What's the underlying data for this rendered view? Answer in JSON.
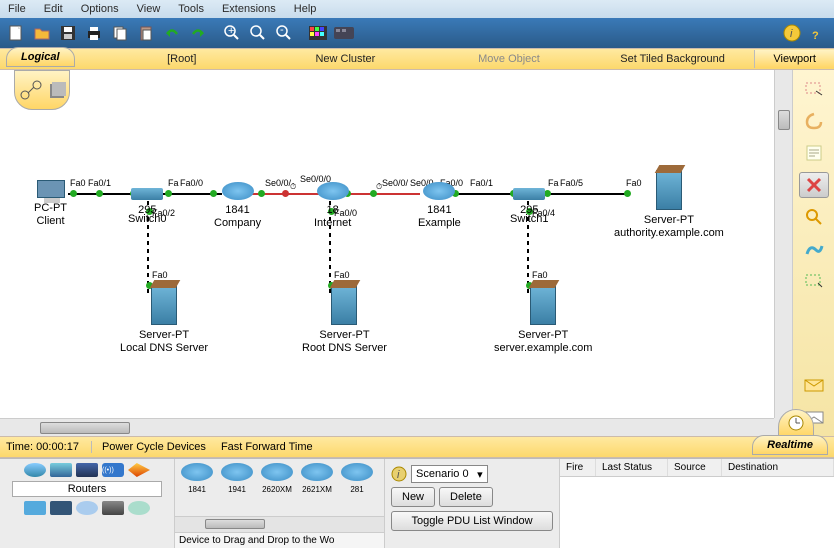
{
  "menu": [
    "File",
    "Edit",
    "Options",
    "View",
    "Tools",
    "Extensions",
    "Help"
  ],
  "logical": {
    "tab": "Logical",
    "root": "[Root]",
    "newcluster": "New Cluster",
    "move": "Move Object",
    "tiled": "Set Tiled Background",
    "viewport": "Viewport"
  },
  "time_label": "Time: 00:00:17",
  "power": "Power Cycle Devices",
  "fft": "Fast Forward Time",
  "realtime": "Realtime",
  "category": "Routers",
  "models": [
    "1841",
    "1941",
    "2620XM",
    "2621XM",
    "281"
  ],
  "hint": "Device to Drag and Drop to the Wo",
  "scenario": "Scenario 0",
  "newbtn": "New",
  "delbtn": "Delete",
  "togglebtn": "Toggle PDU List Window",
  "pdu_cols": [
    "Fire",
    "Last Status",
    "Source",
    "Destination"
  ],
  "devices": {
    "pc": {
      "t": "PC-PT",
      "n": "Client"
    },
    "sw0": {
      "t": "295",
      "n": "Switch0"
    },
    "r1": {
      "t": "1841",
      "n": "Company"
    },
    "r2": {
      "t": "18",
      "n": "Internet"
    },
    "r3": {
      "t": "1841",
      "n": "Example"
    },
    "sw1": {
      "t": "295",
      "n": "Switch1"
    },
    "srv1": {
      "t": "Server-PT",
      "n": "authority.example.com"
    },
    "srv2": {
      "t": "Server-PT",
      "n": "Local DNS Server"
    },
    "srv3": {
      "t": "Server-PT",
      "n": "Root DNS Server"
    },
    "srv4": {
      "t": "Server-PT",
      "n": "server.example.com"
    }
  },
  "ports": {
    "p1": "Fa0",
    "p2": "Fa0/1",
    "p3": "Fa",
    "p4": "Fa0/0",
    "p5": "Se0/0/",
    "p6": "Se0/0/0",
    "p7": "Se0/0/",
    "p8": "Se0/0",
    "p9": "Fa0/0",
    "p10": "Fa0/1",
    "p11": "Fa",
    "p12": "Fa0/5",
    "p13": "Fa0",
    "p14": "Fa0/2",
    "p15": "Fa0",
    "p16": "Fa0/0",
    "p17": "Fa0",
    "p18": "Fa0/4",
    "p19": "Fa0"
  }
}
